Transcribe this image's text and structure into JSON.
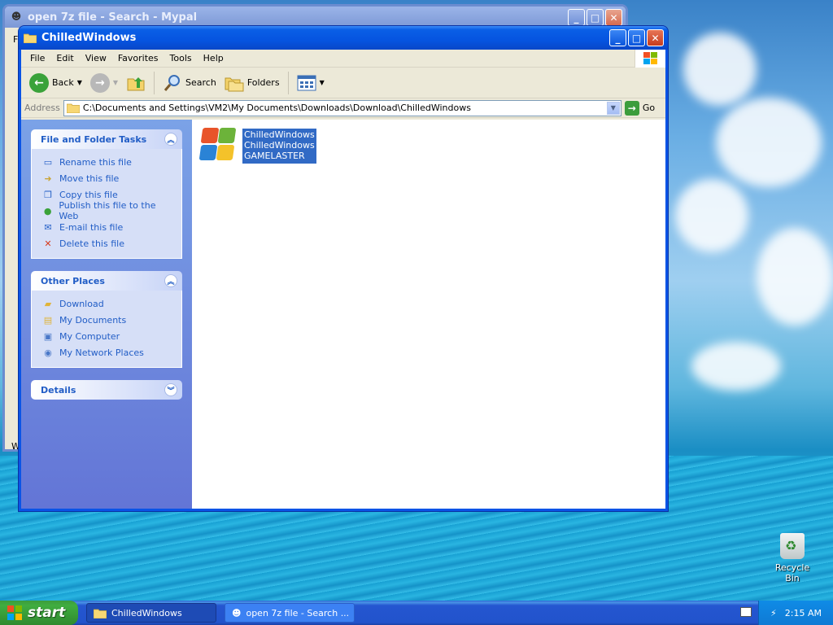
{
  "bg_window": {
    "title": "open 7z file - Search - Mypal",
    "left_edge_chars": [
      "F",
      "W"
    ]
  },
  "window": {
    "title": "ChilledWindows",
    "controls": [
      "minimize",
      "maximize",
      "close"
    ]
  },
  "menu": [
    "File",
    "Edit",
    "View",
    "Favorites",
    "Tools",
    "Help"
  ],
  "toolbar": {
    "back": "Back",
    "search": "Search",
    "folders": "Folders"
  },
  "address": {
    "label": "Address",
    "path": "C:\\Documents and Settings\\VM2\\My Documents\\Downloads\\Download\\ChilledWindows",
    "go": "Go"
  },
  "tasks": {
    "file_folder": {
      "title": "File and Folder Tasks",
      "items": [
        "Rename this file",
        "Move this file",
        "Copy this file",
        "Publish this file to the Web",
        "E-mail this file",
        "Delete this file"
      ]
    },
    "other_places": {
      "title": "Other Places",
      "items": [
        "Download",
        "My Documents",
        "My Computer",
        "My Network Places"
      ]
    },
    "details": {
      "title": "Details"
    }
  },
  "file": {
    "lines": [
      "ChilledWindows",
      "ChilledWindows",
      "GAMELASTER"
    ]
  },
  "desktop": {
    "recycle_bin": "Recycle Bin"
  },
  "taskbar": {
    "start": "start",
    "tasks": [
      "ChilledWindows",
      "open 7z file - Search ..."
    ],
    "clock": "2:15 AM"
  },
  "colors": {
    "xp_blue": "#0a54e6",
    "taskpane_link": "#215dc6",
    "selection": "#316ac5",
    "start_green": "#3c9c3c"
  }
}
